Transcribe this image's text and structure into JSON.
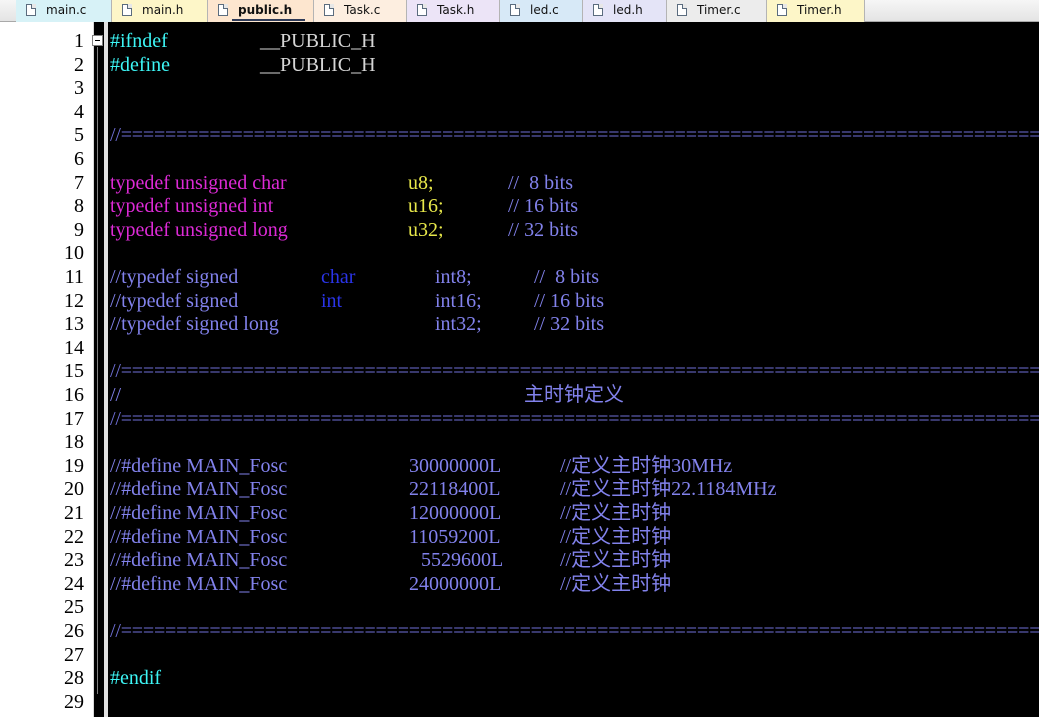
{
  "tabs": [
    {
      "label": "main.c",
      "color": "#d7f2f7",
      "active": false
    },
    {
      "label": "main.h",
      "color": "#fdf6c8",
      "active": false
    },
    {
      "label": "public.h",
      "color": "#fde6cf",
      "active": true
    },
    {
      "label": "Task.c",
      "color": "#fdeee0",
      "active": false
    },
    {
      "label": "Task.h",
      "color": "#ece4f7",
      "active": false
    },
    {
      "label": "led.c",
      "color": "#d7e9f7",
      "active": false
    },
    {
      "label": "led.h",
      "color": "#e4e4f7",
      "active": false
    },
    {
      "label": "Timer.c",
      "color": "#ececec",
      "active": false
    },
    {
      "label": "Timer.h",
      "color": "#fdf6c8",
      "active": false
    }
  ],
  "line_numbers": [
    "1",
    "2",
    "3",
    "4",
    "5",
    "6",
    "7",
    "8",
    "9",
    "10",
    "11",
    "12",
    "13",
    "14",
    "15",
    "16",
    "17",
    "18",
    "19",
    "20",
    "21",
    "22",
    "23",
    "24",
    "25",
    "26",
    "27",
    "28",
    "29"
  ],
  "code": {
    "l1": {
      "a": "#ifndef",
      "b": "__PUBLIC_H"
    },
    "l2": {
      "a": "#define",
      "b": "__PUBLIC_H"
    },
    "sep": "//==================================================================================================",
    "l7": {
      "a": "typedef unsigned char",
      "b": "u8;",
      "c": "//  8 bits"
    },
    "l8": {
      "a": "typedef unsigned int",
      "b": "u16;",
      "c": "// 16 bits"
    },
    "l9": {
      "a": "typedef unsigned long",
      "b": "u32;",
      "c": "// 32 bits"
    },
    "l11": {
      "a": "//typedef signed ",
      "k": "char",
      "b": "int8;",
      "c": "//  8 bits"
    },
    "l12": {
      "a": "//typedef signed ",
      "k": "int",
      "b": "int16;",
      "c": "// 16 bits"
    },
    "l13": {
      "a": "//typedef signed long",
      "b": "int32;",
      "c": "// 32 bits"
    },
    "l16": {
      "a": "//",
      "b": "主时钟定义"
    },
    "l19": {
      "a": "//#define MAIN_Fosc",
      "b": "30000000L",
      "c": "//定义主时钟30MHz"
    },
    "l20": {
      "a": "//#define MAIN_Fosc",
      "b": "22118400L",
      "c": "//定义主时钟22.1184MHz"
    },
    "l21": {
      "a": "//#define MAIN_Fosc",
      "b": "12000000L",
      "c": "//定义主时钟"
    },
    "l22": {
      "a": "//#define MAIN_Fosc",
      "b": "11059200L",
      "c": "//定义主时钟"
    },
    "l23": {
      "a": "//#define MAIN_Fosc",
      "b": "5529600L",
      "c": "//定义主时钟"
    },
    "l24": {
      "a": "//#define MAIN_Fosc",
      "b": "24000000L",
      "c": "//定义主时钟"
    },
    "l28": {
      "a": "#endif"
    }
  }
}
